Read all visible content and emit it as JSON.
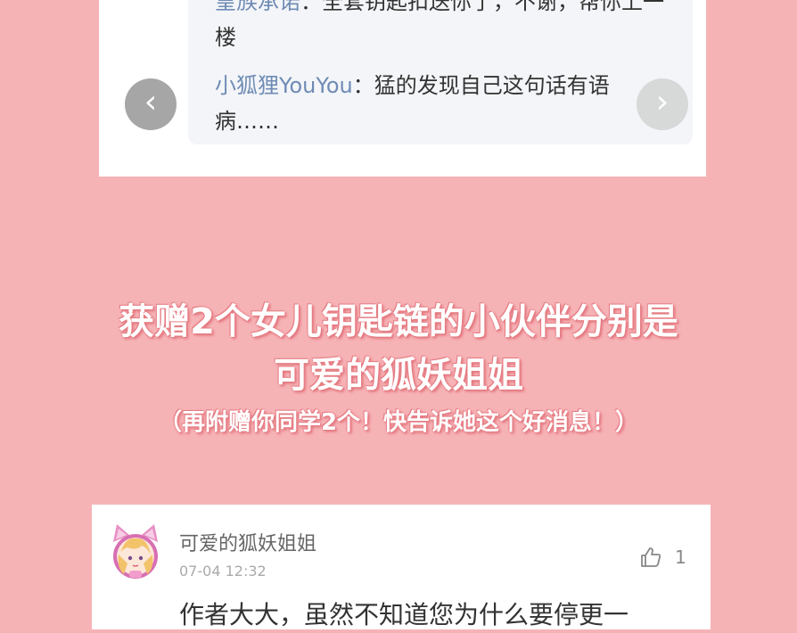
{
  "thread": {
    "replies": [
      {
        "name": "皇族承诺",
        "sep": "：",
        "text": "全套钥匙扣送你了，不谢，帮你上一楼"
      },
      {
        "name": "小狐狸YouYou",
        "sep": "：",
        "text": "猛的发现自己这句话有语病……"
      }
    ],
    "prev_icon": "‹",
    "next_icon": "›"
  },
  "announcement": {
    "line1": "获赠2个女儿钥匙链的小伙伴分别是",
    "line2": "可爱的狐妖姐姐",
    "line3": "（再附赠你同学2个！快告诉她这个好消息！）"
  },
  "comment": {
    "username": "可爱的狐妖姐姐",
    "timestamp": "07-04 12:32",
    "likes": "1",
    "text": "作者大大，虽然不知道您为什么要停更一"
  },
  "icons": {
    "like": "thumbs-up-icon",
    "avatar": "cat-ear-avatar"
  }
}
